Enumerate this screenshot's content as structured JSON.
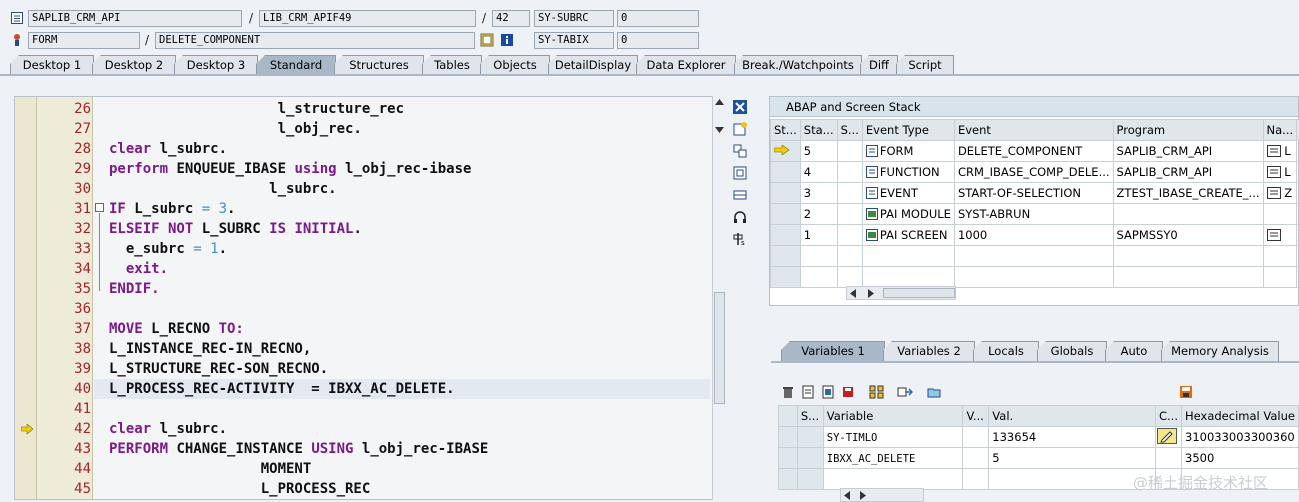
{
  "header": {
    "row1": {
      "program": "SAPLIB_CRM_API",
      "include": "LIB_CRM_APIF49",
      "line": "42",
      "var_name": "SY-SUBRC",
      "var_value": "0"
    },
    "row2": {
      "type": "FORM",
      "name": "DELETE_COMPONENT",
      "var_name": "SY-TABIX",
      "var_value": "0"
    },
    "sep": "/"
  },
  "tabs": [
    "Desktop 1",
    "Desktop 2",
    "Desktop 3",
    "Standard",
    "Structures",
    "Tables",
    "Objects",
    "DetailDisplay",
    "Data Explorer",
    "Break./Watchpoints",
    "Diff",
    "Script"
  ],
  "active_tab": "Standard",
  "editor": {
    "lines": [
      {
        "n": "26",
        "parts": [
          {
            "t": "                    l_structure_rec",
            "c": ""
          }
        ]
      },
      {
        "n": "27",
        "parts": [
          {
            "t": "                    l_obj_rec.",
            "c": ""
          }
        ]
      },
      {
        "n": "28",
        "parts": [
          {
            "t": "clear",
            "c": "kw"
          },
          {
            "t": " l_subrc.",
            "c": ""
          }
        ]
      },
      {
        "n": "29",
        "parts": [
          {
            "t": "perform",
            "c": "kw"
          },
          {
            "t": " ENQUEUE_IBASE ",
            "c": ""
          },
          {
            "t": "using",
            "c": "kw"
          },
          {
            "t": " l_obj_rec-ibase",
            "c": ""
          }
        ]
      },
      {
        "n": "30",
        "parts": [
          {
            "t": "                   l_subrc.",
            "c": ""
          }
        ]
      },
      {
        "n": "31",
        "parts": [
          {
            "t": "IF",
            "c": "kw"
          },
          {
            "t": " L_subrc ",
            "c": ""
          },
          {
            "t": "= 3",
            "c": "num"
          },
          {
            "t": ".",
            "c": ""
          }
        ]
      },
      {
        "n": "32",
        "parts": [
          {
            "t": "ELSEIF NOT",
            "c": "kw"
          },
          {
            "t": " L_SUBRC ",
            "c": ""
          },
          {
            "t": "IS INITIAL",
            "c": "kw"
          },
          {
            "t": ".",
            "c": ""
          }
        ]
      },
      {
        "n": "33",
        "parts": [
          {
            "t": "  e_subrc ",
            "c": ""
          },
          {
            "t": "= 1",
            "c": "num"
          },
          {
            "t": ".",
            "c": ""
          }
        ]
      },
      {
        "n": "34",
        "parts": [
          {
            "t": "  exit.",
            "c": "kw"
          }
        ]
      },
      {
        "n": "35",
        "parts": [
          {
            "t": "ENDIF.",
            "c": "kw"
          }
        ]
      },
      {
        "n": "36",
        "parts": [
          {
            "t": "",
            "c": ""
          }
        ]
      },
      {
        "n": "37",
        "parts": [
          {
            "t": "MOVE",
            "c": "kw"
          },
          {
            "t": " L_RECNO ",
            "c": ""
          },
          {
            "t": "TO:",
            "c": "kw"
          }
        ]
      },
      {
        "n": "38",
        "parts": [
          {
            "t": "L_INSTANCE_REC-IN_RECNO,",
            "c": ""
          }
        ]
      },
      {
        "n": "39",
        "parts": [
          {
            "t": "L_STRUCTURE_REC-SON_RECNO.",
            "c": ""
          }
        ]
      },
      {
        "n": "40",
        "parts": [
          {
            "t": "L_PROCESS_REC-ACTIVITY  = IBXX_AC_DELETE.",
            "c": ""
          }
        ]
      },
      {
        "n": "41",
        "parts": [
          {
            "t": "",
            "c": ""
          }
        ]
      },
      {
        "n": "42",
        "parts": [
          {
            "t": "clear",
            "c": "kw"
          },
          {
            "t": " l_subrc.",
            "c": ""
          }
        ]
      },
      {
        "n": "43",
        "parts": [
          {
            "t": "PERFORM",
            "c": "kw"
          },
          {
            "t": " CHANGE_INSTANCE ",
            "c": ""
          },
          {
            "t": "USING",
            "c": "kw"
          },
          {
            "t": " l_obj_rec-IBASE",
            "c": ""
          }
        ]
      },
      {
        "n": "44",
        "parts": [
          {
            "t": "                  MOMENT",
            "c": ""
          }
        ]
      },
      {
        "n": "45",
        "parts": [
          {
            "t": "                  L_PROCESS_REC",
            "c": ""
          }
        ]
      }
    ],
    "current_line": "42",
    "highlight_line": "40"
  },
  "stack": {
    "title": "ABAP and Screen Stack",
    "columns": [
      "St...",
      "Sta...",
      "S...",
      "Event Type",
      "Event",
      "Program",
      "Na...",
      ""
    ],
    "rows": [
      {
        "level": "5",
        "type": "FORM",
        "event": "DELETE_COMPONENT",
        "program": "SAPLIB_CRM_API",
        "na": "L"
      },
      {
        "level": "4",
        "type": "FUNCTION",
        "event": "CRM_IBASE_COMP_DELE...",
        "program": "SAPLIB_CRM_API",
        "na": "L"
      },
      {
        "level": "3",
        "type": "EVENT",
        "event": "START-OF-SELECTION",
        "program": "ZTEST_IBASE_CREATE_...",
        "na": "Z"
      },
      {
        "level": "2",
        "type": "PAI MODULE",
        "event": "SYST-ABRUN",
        "program": "",
        "na": ""
      },
      {
        "level": "1",
        "type": "PAI SCREEN",
        "event": "1000",
        "program": "SAPMSSY0",
        "na": ""
      }
    ]
  },
  "var_tabs": [
    "Variables 1",
    "Variables 2",
    "Locals",
    "Globals",
    "Auto",
    "Memory Analysis"
  ],
  "vars": {
    "columns": [
      "S...",
      "Variable",
      "V...",
      "Val.",
      "C...",
      "Hexadecimal Value"
    ],
    "rows": [
      {
        "name": "SY-TIMLO",
        "value": "133654",
        "hex": "310033003300360"
      },
      {
        "name": "IBXX_AC_DELETE",
        "value": "5",
        "hex": "3500"
      }
    ]
  },
  "watermark": "@稀土掘金技术社区",
  "colors": {
    "keyword": "#7b1a8a",
    "number": "#3f8fd0",
    "linenum": "#a3262a",
    "tab_active": "#a8b8c6"
  }
}
